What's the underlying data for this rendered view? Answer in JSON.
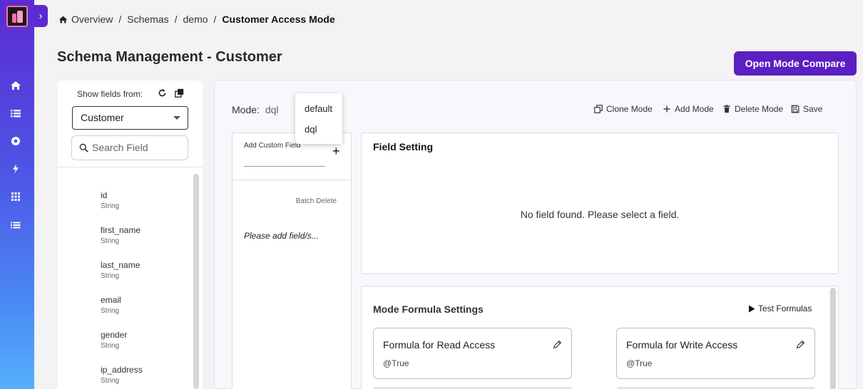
{
  "breadcrumb": {
    "items": [
      "Overview",
      "Schemas",
      "demo"
    ],
    "current": "Customer Access Mode",
    "separator": "/"
  },
  "page": {
    "title": "Schema Management - Customer"
  },
  "header": {
    "compare_button": "Open Mode Compare"
  },
  "left_panel": {
    "show_fields_label": "Show fields from:",
    "selected_source": "Customer",
    "search_placeholder": "Search Field",
    "fields": [
      {
        "name": "id",
        "type": "String"
      },
      {
        "name": "first_name",
        "type": "String"
      },
      {
        "name": "last_name",
        "type": "String"
      },
      {
        "name": "email",
        "type": "String"
      },
      {
        "name": "gender",
        "type": "String"
      },
      {
        "name": "ip_address",
        "type": "String"
      }
    ]
  },
  "mode_bar": {
    "label": "Mode:",
    "value": "dql",
    "options": [
      "default",
      "dql"
    ],
    "actions": {
      "clone": "Clone Mode",
      "add": "Add Mode",
      "delete": "Delete Mode",
      "save": "Save"
    }
  },
  "custom_fields": {
    "label": "Add Custom Field",
    "batch_delete": "Batch Delete",
    "empty_text": "Please add field/s..."
  },
  "field_setting": {
    "title": "Field Setting",
    "empty_text": "No field found. Please select a field."
  },
  "mode_formula": {
    "title": "Mode Formula Settings",
    "test_button": "Test Formulas",
    "cards": [
      {
        "title": "Formula for Read Access",
        "value": "@True"
      },
      {
        "title": "Formula for Write Access",
        "value": "@True"
      }
    ]
  },
  "colors": {
    "accent": "#5b1fc2",
    "sidebar_top": "#5b2bd0",
    "sidebar_bottom": "#56b0fb",
    "logo_pink": "#ff6fae"
  },
  "icons": [
    "logo-icon",
    "expand-icon",
    "home-icon",
    "list-icon",
    "circle-icon",
    "bolt-icon",
    "grid-icon",
    "menu-list-icon",
    "refresh-icon",
    "copy-icon",
    "search-icon",
    "clone-icon",
    "plus-icon",
    "trash-icon",
    "save-icon",
    "play-icon",
    "pencil-icon"
  ]
}
